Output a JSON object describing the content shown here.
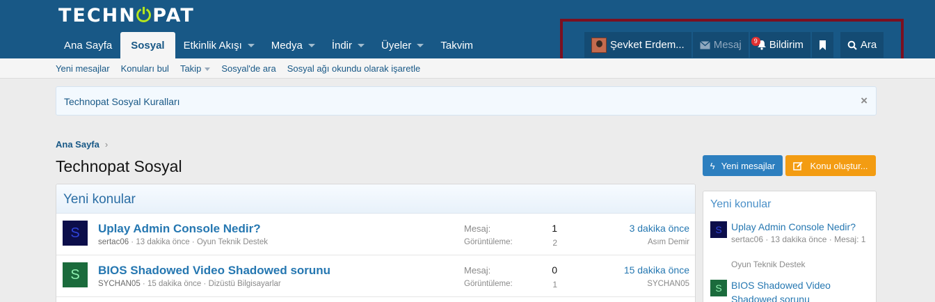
{
  "header": {
    "logo_text": "TECHNOPAT",
    "nav": [
      {
        "label": "Ana Sayfa"
      },
      {
        "label": "Sosyal"
      },
      {
        "label": "Etkinlik Akışı"
      },
      {
        "label": "Medya"
      },
      {
        "label": "İndir"
      },
      {
        "label": "Üyeler"
      },
      {
        "label": "Takvim"
      }
    ],
    "user": {
      "name": "Şevket Erdem...",
      "messages_label": "Mesaj",
      "alerts_label": "Bildirim",
      "alerts_count": "9",
      "search_label": "Ara"
    }
  },
  "subnav": {
    "items": [
      "Yeni mesajlar",
      "Konuları bul",
      "Takip",
      "Sosyal'de ara",
      "Sosyal ağı okundu olarak işaretle"
    ]
  },
  "notice": {
    "text": "Technopat Sosyal Kuralları",
    "close": "×"
  },
  "breadcrumb": {
    "home": "Ana Sayfa",
    "separator": "›"
  },
  "page": {
    "title": "Technopat Sosyal",
    "new_posts_button": "Yeni mesajlar",
    "create_thread_button": "Konu oluştur..."
  },
  "block": {
    "title": "Yeni konular",
    "threads": [
      {
        "avatar_letter": "S",
        "title": "Uplay Admin Console Nedir?",
        "author": "sertac06",
        "started": "13 dakika önce",
        "forum": "Oyun Teknik Destek",
        "replies_label": "Mesaj:",
        "replies": "1",
        "views_label": "Görüntüleme:",
        "views": "2",
        "last_time": "3 dakika önce",
        "last_user": "Asım Demir"
      },
      {
        "avatar_letter": "S",
        "title": "BIOS Shadowed Video Shadowed sorunu",
        "author": "SYCHAN05",
        "started": "15 dakika önce",
        "forum": "Dizüstü Bilgisayarlar",
        "replies_label": "Mesaj:",
        "replies": "0",
        "views_label": "Görüntüleme:",
        "views": "1",
        "last_time": "15 dakika önce",
        "last_user": "SYCHAN05"
      }
    ]
  },
  "sidebar": {
    "title": "Yeni konular",
    "items": [
      {
        "avatar_letter": "S",
        "title": "Uplay Admin Console Nedir?",
        "meta": "sertac06 · 13 dakika önce · Mesaj: 1",
        "forum": "Oyun Teknik Destek"
      },
      {
        "avatar_letter": "S",
        "title": "BIOS Shadowed Video Shadowed sorunu"
      }
    ]
  },
  "colors": {
    "header_bg": "#185886",
    "link": "#2577b1",
    "highlight_box": "#7b1020",
    "button_blue": "#2d7fbf",
    "button_orange": "#f39c12"
  }
}
